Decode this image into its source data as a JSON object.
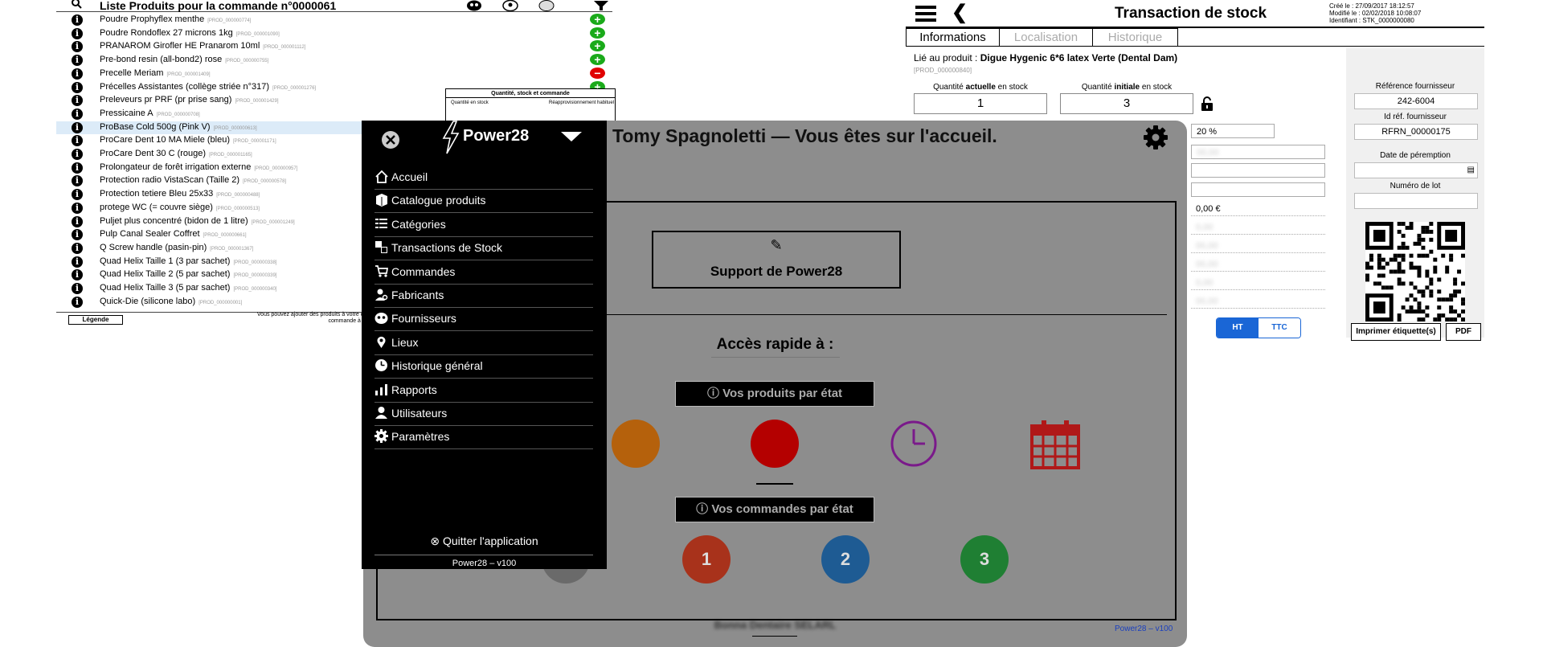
{
  "product_list": {
    "title": "Liste Produits pour la commande n°0000061",
    "items": [
      {
        "name": "Poudre Prophyflex menthe",
        "ref": "[PROD_000000774]",
        "action": "plus"
      },
      {
        "name": "Poudre Rondoflex 27 microns 1kg",
        "ref": "[PROD_000001090]",
        "action": "plus"
      },
      {
        "name": "PRANAROM Girofler HE Pranarom 10ml",
        "ref": "[PROD_000001112]",
        "action": "plus"
      },
      {
        "name": "Pre-bond resin (all-bond2) rose",
        "ref": "[PROD_000000755]",
        "action": "plus"
      },
      {
        "name": "Precelle Meriam",
        "ref": "[PROD_000001409]",
        "action": "minus"
      },
      {
        "name": "Précelles Assistantes (collège striée n°317)",
        "ref": "[PROD_000001276]",
        "action": "plus"
      },
      {
        "name": "Preleveurs pr PRF (pr prise sang)",
        "ref": "[PROD_000001429]",
        "action": "plus"
      },
      {
        "name": "Pressicaine A",
        "ref": "[PROD_000000708]",
        "action": "minus"
      },
      {
        "name": "ProBase Cold 500g (Pink V)",
        "ref": "[PROD_000000613]",
        "action": "",
        "selected": true
      },
      {
        "name": "ProCare Dent 10 MA Miele (bleu)",
        "ref": "[PROD_000001171]",
        "action": ""
      },
      {
        "name": "ProCare Dent 30 C (rouge)",
        "ref": "[PROD_000001165]",
        "action": ""
      },
      {
        "name": "Prolongateur de forêt irrigation externe",
        "ref": "[PROD_000000957]",
        "action": ""
      },
      {
        "name": "Protection radio  VistaScan (Taille 2)",
        "ref": "[PROD_000000578]",
        "action": ""
      },
      {
        "name": "Protection tetiere Bleu 25x33",
        "ref": "[PROD_000000488]",
        "action": ""
      },
      {
        "name": "protege WC (= couvre siège)",
        "ref": "[PROD_000000513]",
        "action": ""
      },
      {
        "name": "Puljet plus concentré (bidon de 1 litre)",
        "ref": "[PROD_000001249]",
        "action": ""
      },
      {
        "name": "Pulp Canal Sealer Coffret",
        "ref": "[PROD_000000661]",
        "action": ""
      },
      {
        "name": "Q Screw handle (pasin-pin)",
        "ref": "[PROD_000001367]",
        "action": ""
      },
      {
        "name": "Quad Helix Taille 1 (3 par sachet)",
        "ref": "[PROD_000000338]",
        "action": ""
      },
      {
        "name": "Quad Helix Taille 2 (5 par sachet)",
        "ref": "[PROD_000000339]",
        "action": ""
      },
      {
        "name": "Quad Helix Taille 3 (5 par sachet)",
        "ref": "[PROD_000000340]",
        "action": ""
      },
      {
        "name": "Quick-Die (silicone labo)",
        "ref": "[PROD_000000001]",
        "action": ""
      }
    ],
    "legend_label": "Légende",
    "footnote": "Vous pouvez ajouter des produits à votre commande à p\ncommande à partir de l'écra",
    "qty_box": {
      "title": "Quantité, stock et commande",
      "col_a": "Quantité en stock",
      "col_b": "Réapprovisionnement habituel"
    }
  },
  "stock": {
    "title": "Transaction de stock",
    "meta": [
      "Créé le : 27/09/2017 18:12:57",
      "Modifié le : 02/02/2018 10:08:07",
      "Identifiant : STK_0000000080"
    ],
    "tabs": [
      "Informations",
      "Localisation",
      "Historique"
    ],
    "linked_prefix": "Lié au produit : ",
    "linked_product": "Digue Hygenic 6*6 latex Verte (Dental Dam)",
    "linked_ref": "[PROD_000000840]",
    "qty_current_label_a": "Quantité ",
    "qty_current_label_b": "actuelle",
    "qty_current_label_c": " en stock",
    "qty_current": "1",
    "qty_initial_label_a": "Quantité ",
    "qty_initial_label_b": "initiale",
    "qty_initial_label_c": " en stock",
    "qty_initial": "3",
    "tva": "20 %",
    "amount": "0,00 €",
    "ht": "HT",
    "ttc": "TTC",
    "supplier_ref_label": "Référence fournisseur",
    "supplier_ref": "242-6004",
    "supplier_id_label": "Id réf. fournisseur",
    "supplier_id": "RFRN_00000175",
    "expiry_label": "Date de péremption",
    "lot_label": "Numéro de lot",
    "print_btn": "Imprimer étiquette(s)",
    "pdf_btn": "PDF"
  },
  "home": {
    "welcome": "Tomy Spagnoletti — Vous êtes sur l'accueil.",
    "support": "Support de Power28",
    "quick_access": "Accès rapide à :",
    "products_by_state": "Vos produits par état",
    "orders_by_state": "Vos commandes par état",
    "order_states": [
      "1",
      "2",
      "3"
    ],
    "footer_company": "Bonna Dentaire SELARL",
    "footer_version": "Power28 – v100"
  },
  "menu": {
    "brand": "Power28",
    "items": [
      {
        "label": "Accueil",
        "icon": "home-icon"
      },
      {
        "label": "Catalogue produits",
        "icon": "catalog-icon"
      },
      {
        "label": "Catégories",
        "icon": "categories-icon"
      },
      {
        "label": "Transactions de Stock",
        "icon": "stock-transactions-icon"
      },
      {
        "label": "Commandes",
        "icon": "cart-icon"
      },
      {
        "label": "Fabricants",
        "icon": "manufacturer-icon"
      },
      {
        "label": "Fournisseurs",
        "icon": "suppliers-icon"
      },
      {
        "label": "Lieux",
        "icon": "location-pin-icon"
      },
      {
        "label": "Historique général",
        "icon": "history-clock-icon"
      },
      {
        "label": "Rapports",
        "icon": "bar-chart-icon"
      },
      {
        "label": "Utilisateurs",
        "icon": "user-icon"
      },
      {
        "label": "Paramètres",
        "icon": "gear-icon"
      }
    ],
    "quit": "Quitter l'application",
    "version": "Power28 – v100"
  },
  "colors": {
    "plus": "#1aaa1a",
    "minus": "#e00000",
    "selected_row": "#dcebf8",
    "ht_active": "#1a66d6",
    "orange": "#b5610c",
    "red": "#b40000",
    "purple": "#7a1a8a",
    "calendar": "#b01818",
    "order1": "#a8321b",
    "order2": "#1e5b93",
    "order3": "#1f7f33",
    "overlay": "#8d8d8d"
  }
}
